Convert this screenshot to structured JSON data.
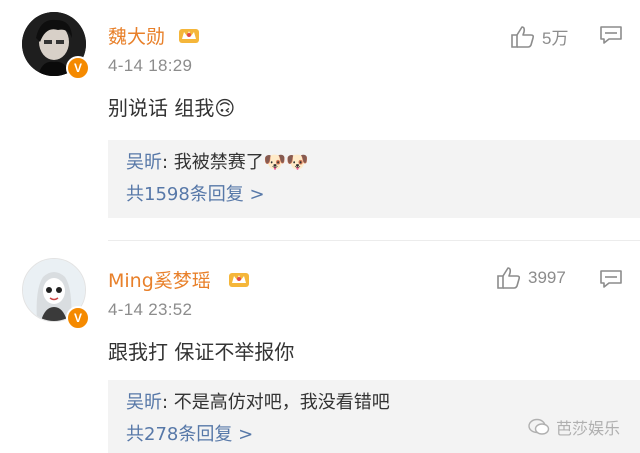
{
  "comments": [
    {
      "username": "魏大勋",
      "time": "4-14 18:29",
      "text": "别说话 组我🙃",
      "likes": "5万",
      "reply": {
        "user": "吴昕",
        "text": "我被禁赛了🐶🐶",
        "count_label": "共1598条回复 >"
      }
    },
    {
      "username": "Ming奚梦瑶",
      "time": "4-14 23:52",
      "text": "跟我打 保证不举报你",
      "likes": "3997",
      "reply": {
        "user": "吴昕",
        "text": "不是高仿对吧，我没看错吧",
        "count_label": "共278条回复 >"
      }
    }
  ],
  "watermark": "芭莎娱乐",
  "colors": {
    "username": "#e8802a",
    "link": "#5778a8",
    "verified_badge": "#f58a00"
  }
}
